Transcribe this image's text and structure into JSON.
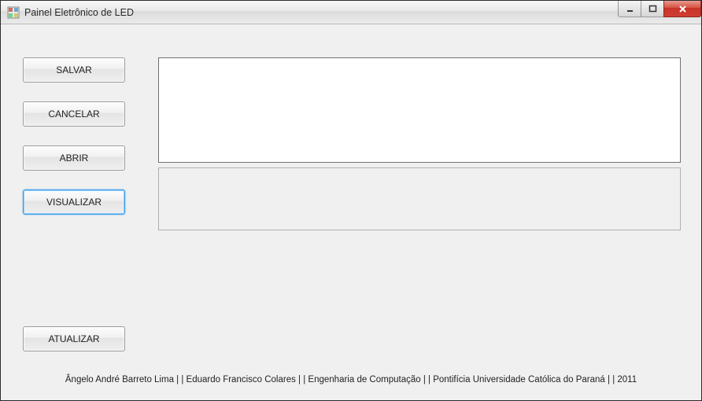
{
  "window": {
    "title": "Painel Eletrônico de LED"
  },
  "buttons": {
    "save": "SALVAR",
    "cancel": "CANCELAR",
    "open": "ABRIR",
    "visualize": "VISUALIZAR",
    "update": "ATUALIZAR"
  },
  "input": {
    "value": ""
  },
  "footer": {
    "text": "Ângelo André Barreto Lima | | Eduardo Francisco Colares | | Engenharia de Computação | | Pontifícia Universidade Católica do Paraná | | 2011"
  }
}
